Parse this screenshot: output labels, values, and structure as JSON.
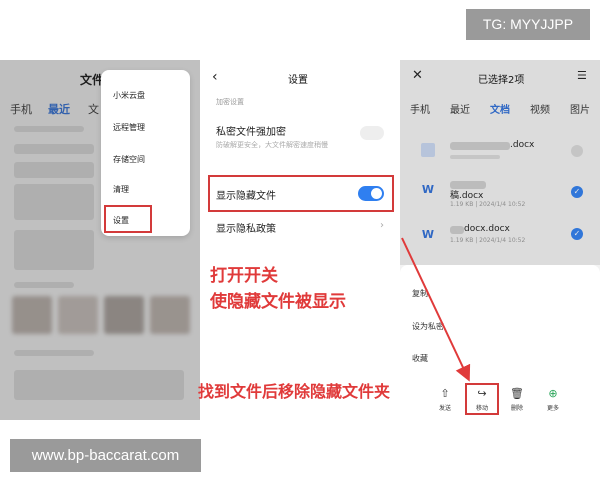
{
  "watermark": "TG: MYYJJPP",
  "site_url": "www.bp-baccarat.com",
  "panel1": {
    "title": "文件",
    "tabs": [
      "手机",
      "最近",
      "文"
    ],
    "menu": [
      "小米云盘",
      "远程管理",
      "存储空间",
      "清理",
      "设置"
    ]
  },
  "panel2": {
    "title": "设置",
    "section": "加密设置",
    "rows": [
      {
        "title": "私密文件强加密",
        "subtitle": "防破解更安全，大文件解密速度稍慢",
        "toggle": "off"
      },
      {
        "title": "显示隐藏文件",
        "toggle": "on"
      },
      {
        "title": "显示隐私政策"
      }
    ],
    "annotation_line1": "打开开关",
    "annotation_line2": "使隐藏文件被显示"
  },
  "panel3": {
    "title": "已选择2项",
    "tabs": [
      "手机",
      "最近",
      "文档",
      "视频",
      "图片"
    ],
    "files": [
      {
        "name": ".docx",
        "meta": "",
        "checked": false
      },
      {
        "name": "稿.docx",
        "meta": "1.19 KB | 2024/1/4 10:52",
        "checked": true
      },
      {
        "name": "docx.docx",
        "meta": "1.19 KB | 2024/1/4 10:52",
        "checked": true
      }
    ],
    "sheet_items": [
      "复制",
      "设为私密",
      "收藏"
    ],
    "actions": [
      "发送",
      "移动",
      "删除",
      "更多"
    ]
  },
  "bottom_annotation": "找到文件后移除隐藏文件夹",
  "colors": {
    "accent": "#2f7ff0",
    "highlight": "#d33a3a",
    "annotation": "#e03a3a"
  }
}
